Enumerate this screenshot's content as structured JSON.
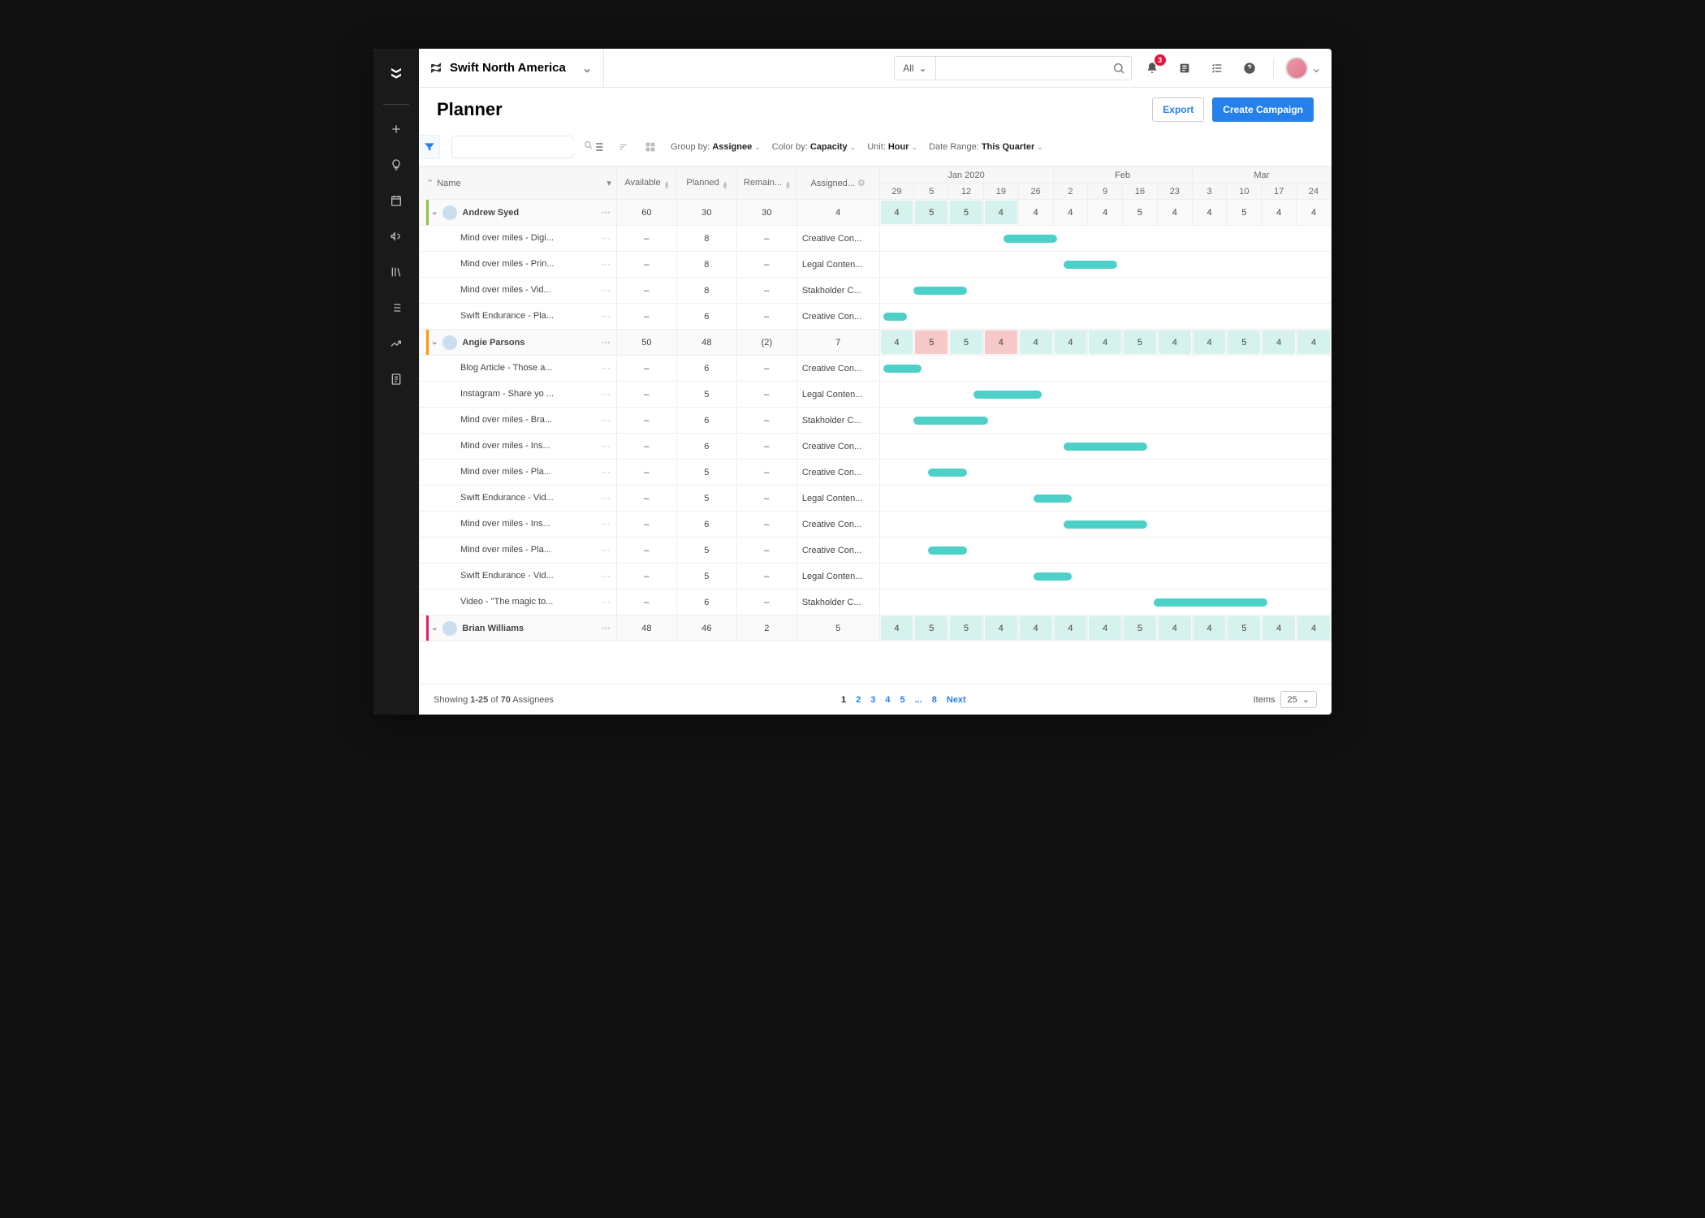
{
  "topbar": {
    "brand": "Swift North America",
    "search_filter": "All",
    "notif_count": "3"
  },
  "page": {
    "title": "Planner",
    "export": "Export",
    "create": "Create Campaign"
  },
  "toolbar": {
    "group_by_label": "Group by:",
    "group_by_value": "Assignee",
    "color_by_label": "Color by:",
    "color_by_value": "Capacity",
    "unit_label": "Unit:",
    "unit_value": "Hour",
    "date_range_label": "Date Range:",
    "date_range_value": "This Quarter"
  },
  "columns": {
    "name": "Name",
    "available": "Available",
    "planned": "Planned",
    "remaining": "Remain...",
    "assigned": "Assigned..."
  },
  "timeline": {
    "months": [
      "Jan 2020",
      "Feb",
      "Mar"
    ],
    "days": [
      "29",
      "5",
      "12",
      "19",
      "26",
      "2",
      "9",
      "16",
      "23",
      "3",
      "10",
      "17",
      "24"
    ]
  },
  "rows": [
    {
      "type": "assignee",
      "color": "#8bc34a",
      "name": "Andrew Syed",
      "available": "60",
      "planned": "30",
      "remaining": "30",
      "assigned": "4",
      "caps": [
        {
          "v": "4",
          "s": "ok"
        },
        {
          "v": "5",
          "s": "ok"
        },
        {
          "v": "5",
          "s": "ok"
        },
        {
          "v": "4",
          "s": "ok"
        },
        {
          "v": "4",
          "s": ""
        },
        {
          "v": "4",
          "s": ""
        },
        {
          "v": "4",
          "s": ""
        },
        {
          "v": "5",
          "s": ""
        },
        {
          "v": "4",
          "s": ""
        },
        {
          "v": "4",
          "s": ""
        },
        {
          "v": "5",
          "s": ""
        },
        {
          "v": "4",
          "s": ""
        },
        {
          "v": "4",
          "s": ""
        }
      ]
    },
    {
      "type": "task",
      "name": "Mind over miles - Digi...",
      "planned": "8",
      "assigned": "Creative Con...",
      "bar": {
        "start": 4,
        "span": 2
      }
    },
    {
      "type": "task",
      "name": "Mind over miles - Prin...",
      "planned": "8",
      "assigned": "Legal Conten...",
      "bar": {
        "start": 6,
        "span": 2
      }
    },
    {
      "type": "task",
      "name": "Mind over miles -  Vid...",
      "planned": "8",
      "assigned": "Stakholder C...",
      "bar": {
        "start": 1,
        "span": 2
      }
    },
    {
      "type": "task",
      "name": "Swift Endurance - Pla...",
      "planned": "6",
      "assigned": "Creative Con...",
      "bar": {
        "start": 0,
        "span": 1
      }
    },
    {
      "type": "assignee",
      "color": "#ff9800",
      "name": "Angie Parsons",
      "available": "50",
      "planned": "48",
      "remaining": "(2)",
      "remNeg": true,
      "assigned": "7",
      "caps": [
        {
          "v": "4",
          "s": "ok"
        },
        {
          "v": "5",
          "s": "over"
        },
        {
          "v": "5",
          "s": "ok"
        },
        {
          "v": "4",
          "s": "over"
        },
        {
          "v": "4",
          "s": "ok"
        },
        {
          "v": "4",
          "s": "ok"
        },
        {
          "v": "4",
          "s": "ok"
        },
        {
          "v": "5",
          "s": "ok"
        },
        {
          "v": "4",
          "s": "ok"
        },
        {
          "v": "4",
          "s": "ok"
        },
        {
          "v": "5",
          "s": "ok"
        },
        {
          "v": "4",
          "s": "ok"
        },
        {
          "v": "4",
          "s": "ok"
        }
      ]
    },
    {
      "type": "task",
      "name": "Blog Article - Those a...",
      "planned": "6",
      "assigned": "Creative Con...",
      "bar": {
        "start": 0,
        "span": 1.5
      }
    },
    {
      "type": "task",
      "name": "Instagram - Share yo ...",
      "planned": "5",
      "assigned": "Legal Conten...",
      "bar": {
        "start": 3,
        "span": 2.5
      }
    },
    {
      "type": "task",
      "name": "Mind over miles - Bra...",
      "planned": "6",
      "assigned": "Stakholder C...",
      "bar": {
        "start": 1,
        "span": 2.7
      }
    },
    {
      "type": "task",
      "name": "Mind over miles - Ins...",
      "planned": "6",
      "assigned": "Creative Con...",
      "bar": {
        "start": 6,
        "span": 3
      }
    },
    {
      "type": "task",
      "name": "Mind over miles - Pla...",
      "planned": "5",
      "assigned": "Creative Con...",
      "bar": {
        "start": 1.5,
        "span": 1.5
      }
    },
    {
      "type": "task",
      "name": "Swift Endurance - Vid...",
      "planned": "5",
      "assigned": "Legal Conten...",
      "bar": {
        "start": 5,
        "span": 1.5
      }
    },
    {
      "type": "task",
      "name": "Mind over miles - Ins...",
      "planned": "6",
      "assigned": "Creative Con...",
      "bar": {
        "start": 6,
        "span": 3
      }
    },
    {
      "type": "task",
      "name": "Mind over miles - Pla...",
      "planned": "5",
      "assigned": "Creative Con...",
      "bar": {
        "start": 1.5,
        "span": 1.5
      }
    },
    {
      "type": "task",
      "name": "Swift Endurance - Vid...",
      "planned": "5",
      "assigned": "Legal Conten...",
      "bar": {
        "start": 5,
        "span": 1.5
      }
    },
    {
      "type": "task",
      "name": "Video - \"The magic to...",
      "planned": "6",
      "assigned": "Stakholder C...",
      "bar": {
        "start": 9,
        "span": 4
      }
    },
    {
      "type": "assignee",
      "color": "#e91e63",
      "name": "Brian Williams",
      "available": "48",
      "planned": "46",
      "remaining": "2",
      "assigned": "5",
      "caps": [
        {
          "v": "4",
          "s": "ok"
        },
        {
          "v": "5",
          "s": "ok"
        },
        {
          "v": "5",
          "s": "ok"
        },
        {
          "v": "4",
          "s": "ok"
        },
        {
          "v": "4",
          "s": "ok"
        },
        {
          "v": "4",
          "s": "ok"
        },
        {
          "v": "4",
          "s": "ok"
        },
        {
          "v": "5",
          "s": "ok"
        },
        {
          "v": "4",
          "s": "ok"
        },
        {
          "v": "4",
          "s": "ok"
        },
        {
          "v": "5",
          "s": "ok"
        },
        {
          "v": "4",
          "s": "ok"
        },
        {
          "v": "4",
          "s": "ok"
        }
      ]
    }
  ],
  "footer": {
    "showing_prefix": "Showing ",
    "showing_range": "1-25",
    "showing_mid": " of ",
    "showing_total": "70",
    "showing_suffix": " Assignees",
    "pages": [
      "1",
      "2",
      "3",
      "4",
      "5",
      "...",
      "8"
    ],
    "next": "Next",
    "items_label": "Items",
    "items_value": "25"
  }
}
